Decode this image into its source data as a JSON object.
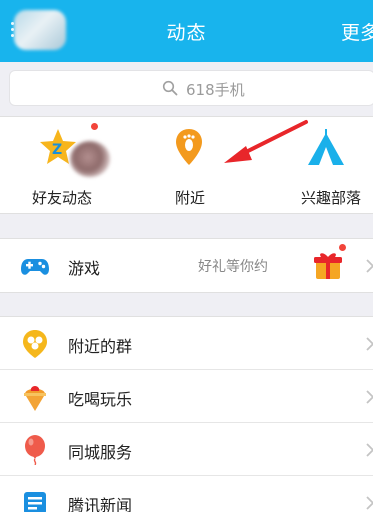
{
  "header": {
    "title": "动态",
    "more_label": "更多"
  },
  "search": {
    "placeholder": "618手机"
  },
  "quick_row": {
    "items": [
      {
        "label": "好友动态",
        "icon": "qzone-star-icon",
        "badge": true
      },
      {
        "label": "附近",
        "icon": "footprint-location-icon",
        "badge": false
      },
      {
        "label": "兴趣部落",
        "icon": "tent-icon",
        "badge": false
      }
    ]
  },
  "game_section": {
    "label": "游戏",
    "hint": "好礼等你约",
    "icon": "gamepad-icon",
    "gift_icon": "gift-box-icon",
    "badge": true
  },
  "list_section": {
    "items": [
      {
        "label": "附近的群",
        "icon": "nearby-group-icon"
      },
      {
        "label": "吃喝玩乐",
        "icon": "ice-cream-icon"
      },
      {
        "label": "同城服务",
        "icon": "balloon-icon"
      },
      {
        "label": "腾讯新闻",
        "icon": "news-icon"
      }
    ]
  },
  "colors": {
    "header_bg": "#18b4ed",
    "badge": "#f2443a",
    "annotation_arrow": "#e8262a"
  }
}
